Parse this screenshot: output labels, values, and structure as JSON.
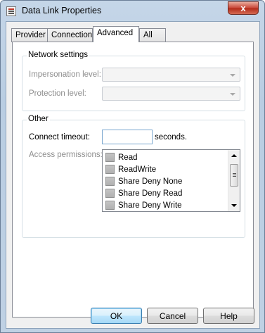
{
  "window": {
    "title": "Data Link Properties",
    "close_glyph": "x",
    "icon": "datalink-icon"
  },
  "tabs": [
    {
      "label": "Provider",
      "active": false
    },
    {
      "label": "Connection",
      "active": false
    },
    {
      "label": "Advanced",
      "active": true
    },
    {
      "label": "All",
      "active": false
    }
  ],
  "network_settings": {
    "title": "Network settings",
    "impersonation_label": "Impersonation level:",
    "impersonation_value": "",
    "protection_label": "Protection level:",
    "protection_value": ""
  },
  "other": {
    "title": "Other",
    "timeout_label": "Connect timeout:",
    "timeout_value": "",
    "timeout_unit": "seconds.",
    "permissions_label": "Access permissions:",
    "permissions": [
      {
        "label": "Read",
        "checked": false
      },
      {
        "label": "ReadWrite",
        "checked": false
      },
      {
        "label": "Share Deny None",
        "checked": false
      },
      {
        "label": "Share Deny Read",
        "checked": false
      },
      {
        "label": "Share Deny Write",
        "checked": false
      }
    ]
  },
  "buttons": {
    "ok": "OK",
    "cancel": "Cancel",
    "help": "Help"
  },
  "colors": {
    "frame": "#bfd1e4",
    "close": "#c9493a",
    "disabled_text": "#8d8d8d"
  }
}
